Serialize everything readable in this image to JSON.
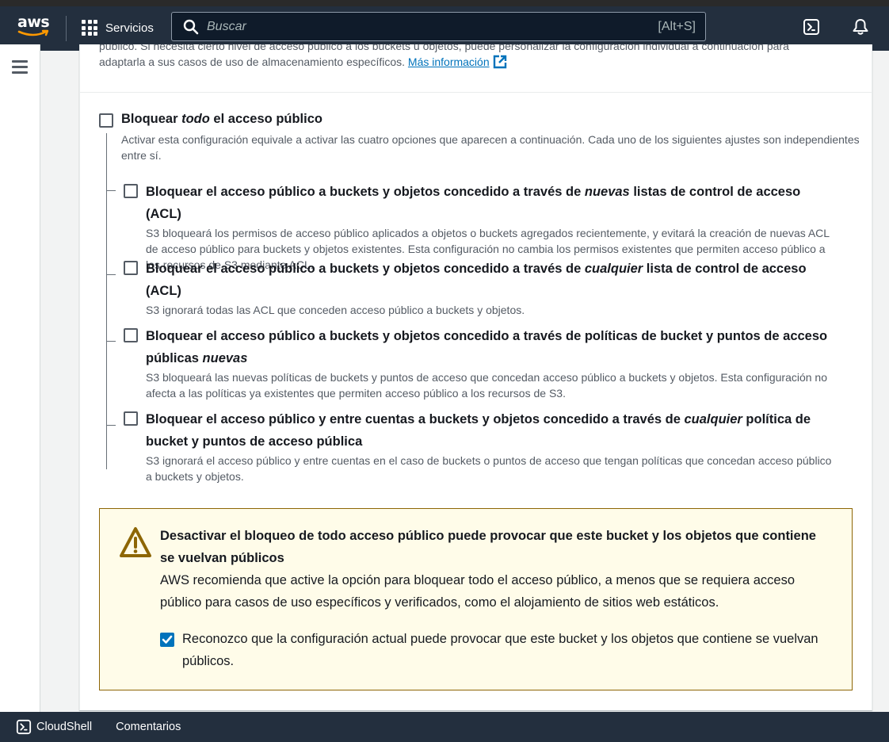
{
  "topbar": {
    "logo_text": "aws",
    "services_label": "Servicios",
    "search_placeholder": "Buscar",
    "search_shortcut": "[Alt+S]"
  },
  "intro": {
    "cut_line": "público. Si necesita cierto nivel de acceso público a los buckets u objetos, puede personalizar la configuración individual a continuación para",
    "text": "adaptarla a sus casos de uso de almacenamiento específicos.",
    "link": "Más información"
  },
  "block_all": {
    "title_pre": "Bloquear ",
    "title_em": "todo",
    "title_post": " el acceso público",
    "desc": "Activar esta configuración equivale a activar las cuatro opciones que aparecen a continuación. Cada uno de los siguientes ajustes son independientes entre sí."
  },
  "options": [
    {
      "title_pre": "Bloquear el acceso público a buckets y objetos concedido a través de ",
      "title_em": "nuevas",
      "title_post": " listas de control de acceso (ACL)",
      "desc": "S3 bloqueará los permisos de acceso público aplicados a objetos o buckets agregados recientemente, y evitará la creación de nuevas ACL de acceso público para buckets y objetos existentes. Esta configuración no cambia los permisos existentes que permiten acceso público a los recursos de S3 mediante ACL."
    },
    {
      "title_pre": "Bloquear el acceso público a buckets y objetos concedido a través de ",
      "title_em": "cualquier",
      "title_post": " lista de control de acceso (ACL)",
      "desc": "S3 ignorará todas las ACL que conceden acceso público a buckets y objetos."
    },
    {
      "title_pre": "Bloquear el acceso público a buckets y objetos concedido a través de políticas de bucket y puntos de acceso públicas ",
      "title_em": "nuevas",
      "title_post": "",
      "desc": "S3 bloqueará las nuevas políticas de buckets y puntos de acceso que concedan acceso público a buckets y objetos. Esta configuración no afecta a las políticas ya existentes que permiten acceso público a los recursos de S3."
    },
    {
      "title_pre": "Bloquear el acceso público y entre cuentas a buckets y objetos concedido a través de ",
      "title_em": "cualquier",
      "title_post": " política de bucket y puntos de acceso pública",
      "desc": "S3 ignorará el acceso público y entre cuentas en el caso de buckets o puntos de acceso que tengan políticas que concedan acceso público a buckets y objetos."
    }
  ],
  "warning": {
    "title": "Desactivar el bloqueo de todo acceso público puede provocar que este bucket y los objetos que contiene se vuelvan públicos",
    "text": "AWS recomienda que active la opción para bloquear todo el acceso público, a menos que se requiera acceso público para casos de uso específicos y verificados, como el alojamiento de sitios web estáticos.",
    "ack": "Reconozco que la configuración actual puede provocar que este bucket y los objetos que contiene se vuelvan públicos.",
    "ack_checked": true
  },
  "footer": {
    "cloudshell": "CloudShell",
    "feedback": "Comentarios"
  },
  "colors": {
    "nav_bg": "#232f3e",
    "link": "#0073bb",
    "warning_bg": "#fffce9",
    "warning_border": "#8d6605"
  }
}
